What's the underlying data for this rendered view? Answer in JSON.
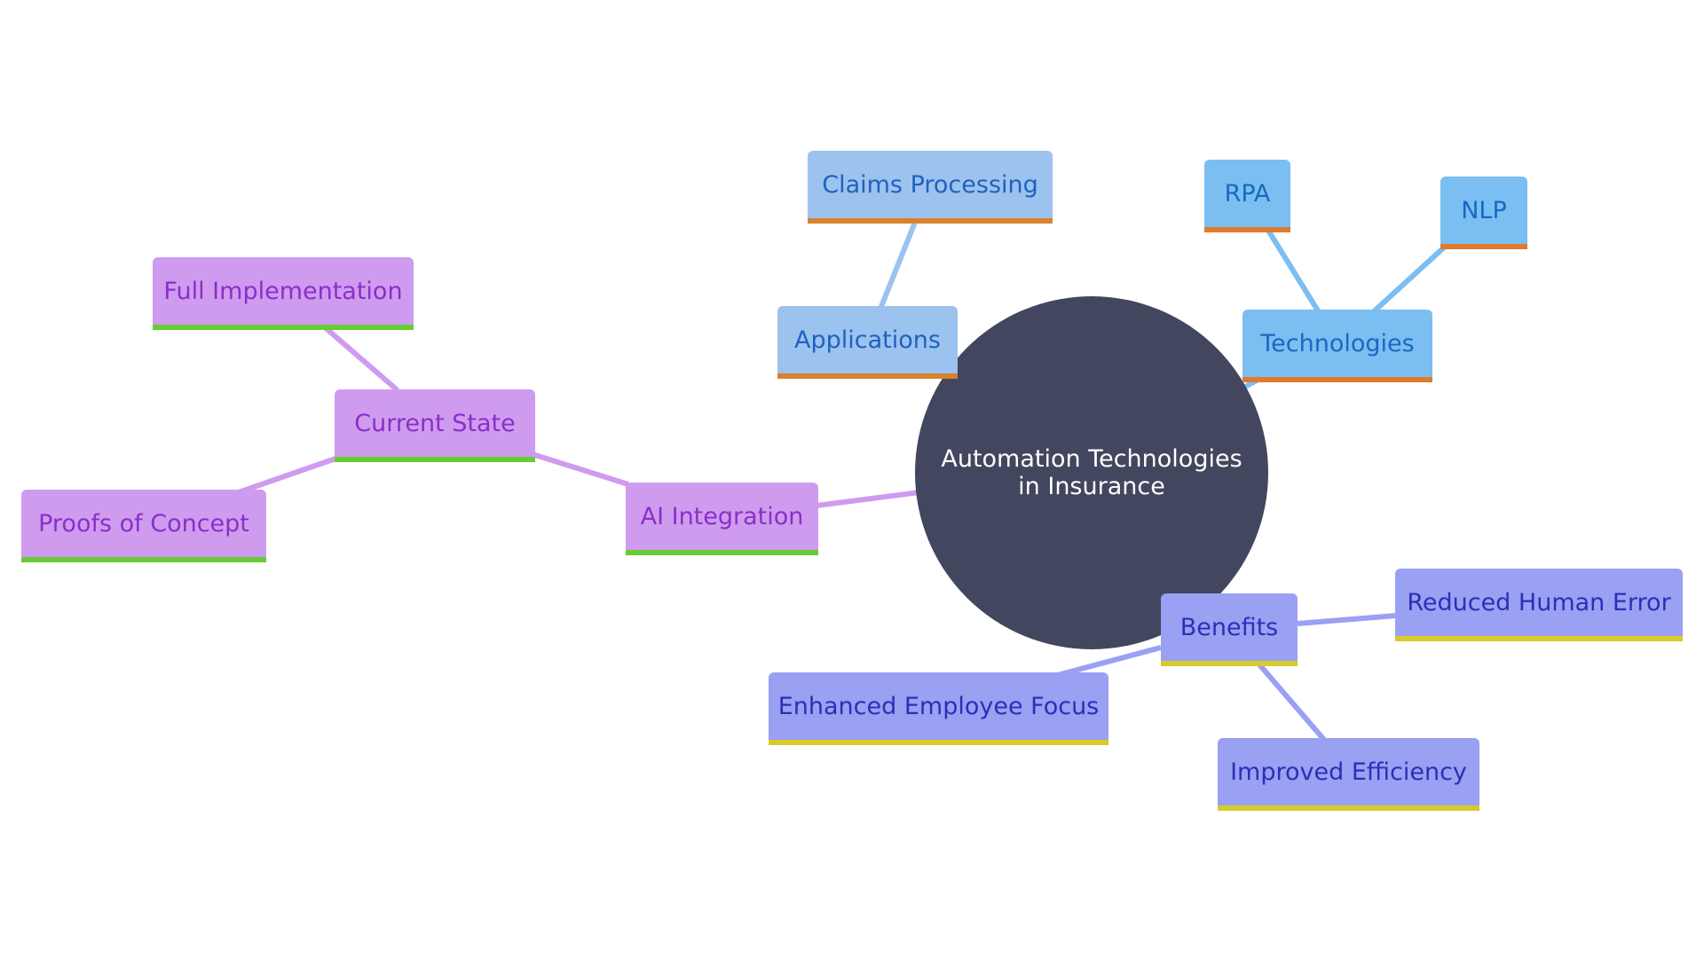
{
  "root": {
    "label": "Automation Technologies in Insurance"
  },
  "branches": {
    "applications": {
      "label": "Applications",
      "children": [
        "Claims Processing"
      ]
    },
    "technologies": {
      "label": "Technologies",
      "children": [
        "RPA",
        "NLP"
      ]
    },
    "ai_integration": {
      "label": "AI Integration"
    },
    "current_state": {
      "label": "Current State",
      "children": [
        "Full Implementation",
        "Proofs of Concept"
      ]
    },
    "benefits": {
      "label": "Benefits",
      "children": [
        "Reduced Human Error",
        "Enhanced Employee Focus",
        "Improved Efficiency"
      ]
    }
  },
  "colors": {
    "root": "#42465e",
    "applications": "#9cc2ef",
    "technologies": "#7bbef2",
    "ai": "#cf9bef",
    "benefits": "#9aa0f2"
  }
}
